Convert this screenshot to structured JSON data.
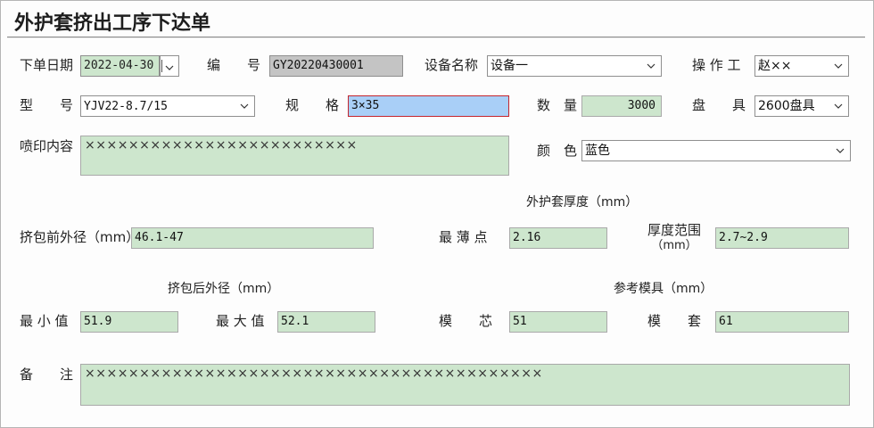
{
  "title": "外护套挤出工序下达单",
  "order_date": {
    "label": "下单日期",
    "value": "2022-04-30"
  },
  "number": {
    "label": "编　　号",
    "value": "GY20220430001"
  },
  "equipment": {
    "label": "设备名称",
    "value": "设备一"
  },
  "operator": {
    "label": "操 作 工",
    "value": "赵××"
  },
  "model": {
    "label": "型　　号",
    "value": "YJV22-8.7/15"
  },
  "spec": {
    "label": "规　　格",
    "value": "3×35"
  },
  "quantity": {
    "label": "数　量",
    "value": "3000"
  },
  "reel": {
    "label": "盘　　具",
    "value": "2600盘具"
  },
  "print_content": {
    "label": "喷印内容",
    "value": "×××××××××××××××××××××××××"
  },
  "color": {
    "label": "颜　色",
    "value": "蓝色"
  },
  "sheath_thickness": {
    "heading": "外护套厚度（mm）",
    "thinnest": {
      "label": "最 薄 点",
      "value": "2.16"
    },
    "range": {
      "label_line1": "厚度范围",
      "label_line2": "（mm）",
      "value": "2.7~2.9"
    }
  },
  "pre_od": {
    "label": "挤包前外径（mm）",
    "value": "46.1-47"
  },
  "post_od": {
    "heading": "挤包后外径（mm）",
    "min": {
      "label": "最 小 值",
      "value": "51.9"
    },
    "max": {
      "label": "最 大 值",
      "value": "52.1"
    }
  },
  "ref_mold": {
    "heading": "参考模具（mm）",
    "core": {
      "label": "模　　芯",
      "value": "51"
    },
    "die": {
      "label": "模　　套",
      "value": "61"
    }
  },
  "remark": {
    "label": "备　　注",
    "value": "××××××××××××××××××××××××××××××××××××××××××"
  },
  "icons": {
    "dropdown": "chevron-down-icon",
    "date": "date-picker-icon"
  }
}
